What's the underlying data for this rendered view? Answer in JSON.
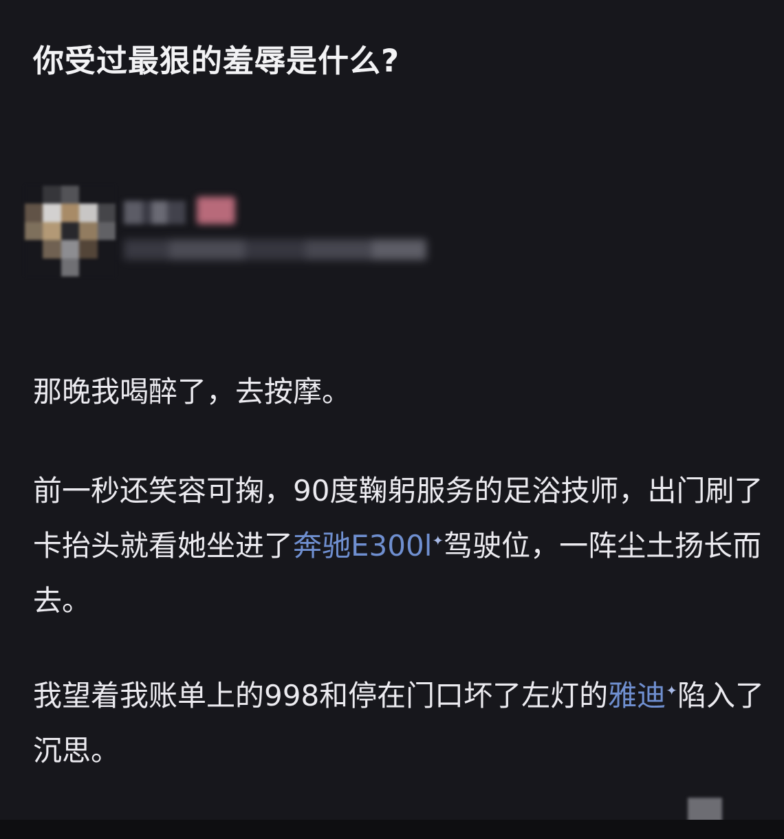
{
  "question": {
    "title": "你受过最狠的羞辱是什么?"
  },
  "answer": {
    "para1": "那晚我喝醉了，去按摩。",
    "para2_a": "前一秒还笑容可掬，90度鞠躬服务的足浴技师，出门刷了卡抬头就看她坐进了",
    "para2_link": "奔驰E300l",
    "para2_b": "驾驶位，一阵尘土扬长而去。",
    "para3_a": "我望着我账单上的998和停在门口坏了左灯的",
    "para3_link": "雅迪",
    "para3_b": "陷入了沉思。"
  },
  "icons": {
    "link_sparkle": "✦"
  },
  "colors": {
    "background": "#17171c",
    "text": "#ecebf0",
    "link": "#6f8fd0"
  }
}
